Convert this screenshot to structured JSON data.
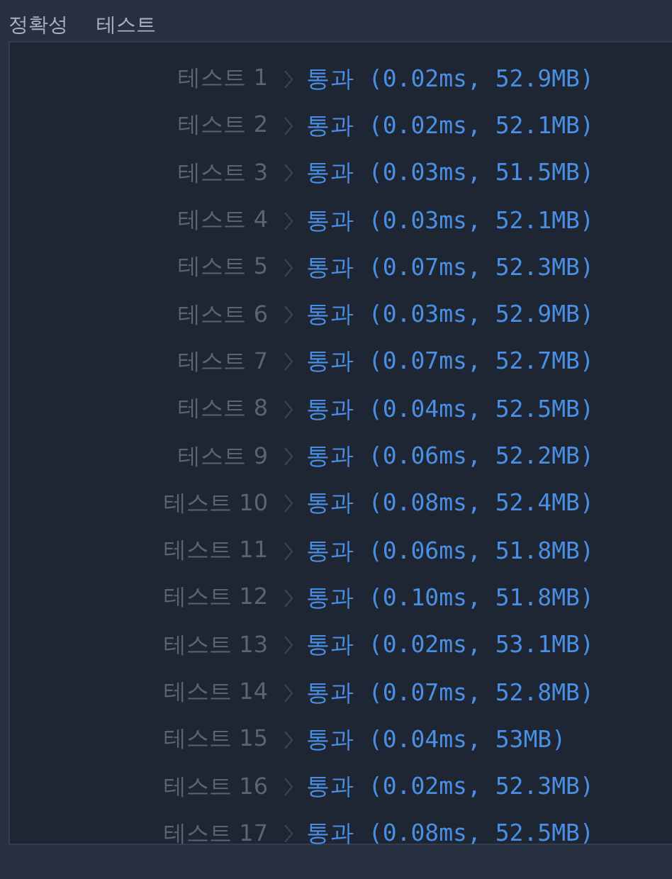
{
  "header": {
    "title": "정확성",
    "label": "테스트"
  },
  "results": [
    {
      "label": "테스트 1",
      "result": "통과 (0.02ms, 52.9MB)"
    },
    {
      "label": "테스트 2",
      "result": "통과 (0.02ms, 52.1MB)"
    },
    {
      "label": "테스트 3",
      "result": "통과 (0.03ms, 51.5MB)"
    },
    {
      "label": "테스트 4",
      "result": "통과 (0.03ms, 52.1MB)"
    },
    {
      "label": "테스트 5",
      "result": "통과 (0.07ms, 52.3MB)"
    },
    {
      "label": "테스트 6",
      "result": "통과 (0.03ms, 52.9MB)"
    },
    {
      "label": "테스트 7",
      "result": "통과 (0.07ms, 52.7MB)"
    },
    {
      "label": "테스트 8",
      "result": "통과 (0.04ms, 52.5MB)"
    },
    {
      "label": "테스트 9",
      "result": "통과 (0.06ms, 52.2MB)"
    },
    {
      "label": "테스트 10",
      "result": "통과 (0.08ms, 52.4MB)"
    },
    {
      "label": "테스트 11",
      "result": "통과 (0.06ms, 51.8MB)"
    },
    {
      "label": "테스트 12",
      "result": "통과 (0.10ms, 51.8MB)"
    },
    {
      "label": "테스트 13",
      "result": "통과 (0.02ms, 53.1MB)"
    },
    {
      "label": "테스트 14",
      "result": "통과 (0.07ms, 52.8MB)"
    },
    {
      "label": "테스트 15",
      "result": "통과 (0.04ms, 53MB)"
    },
    {
      "label": "테스트 16",
      "result": "통과 (0.02ms, 52.3MB)"
    },
    {
      "label": "테스트 17",
      "result": "통과 (0.08ms, 52.5MB)"
    }
  ]
}
